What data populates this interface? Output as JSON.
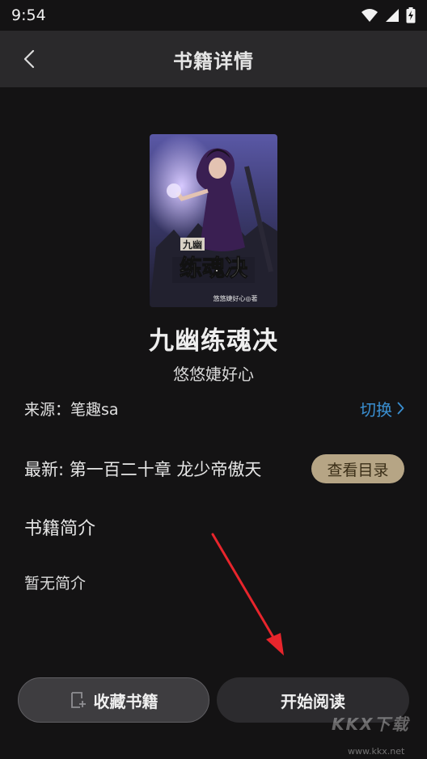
{
  "status_bar": {
    "time": "9:54"
  },
  "header": {
    "title": "书籍详情",
    "back_icon": "chevron-left-icon"
  },
  "book": {
    "title": "九幽练魂决",
    "author": "悠悠婕好心",
    "cover": {
      "title_text": "练魂决",
      "stamp_text": "九幽",
      "author_text": "悠悠婕好心◎著"
    }
  },
  "source": {
    "label": "来源：笔趣sa",
    "switch_label": "切换"
  },
  "latest": {
    "label": "最新: 第一百二十章 龙少帝傲天",
    "toc_button": "查看目录"
  },
  "intro": {
    "heading": "书籍简介",
    "text": "暂无简介"
  },
  "actions": {
    "favorite_label": "收藏书籍",
    "read_label": "开始阅读"
  },
  "watermark": {
    "logo": "KKX下载",
    "url": "www.kkx.net"
  },
  "colors": {
    "accent_link": "#3a8fd1",
    "toc_button_bg": "#b6a585",
    "arrow": "#e8252c"
  }
}
